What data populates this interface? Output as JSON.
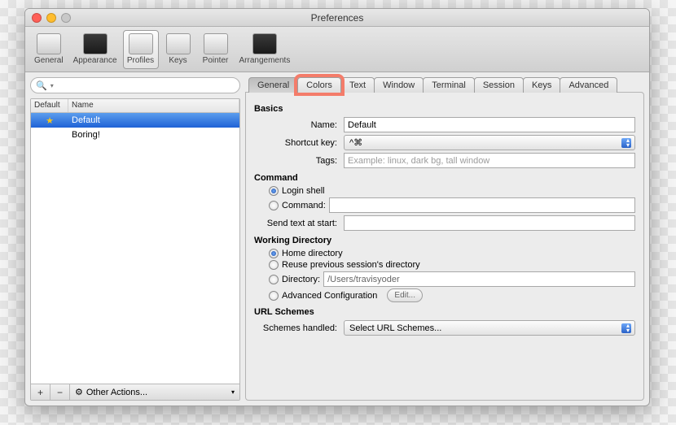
{
  "window": {
    "title": "Preferences"
  },
  "toolbar": {
    "items": [
      {
        "label": "General",
        "icon": "slider-icon"
      },
      {
        "label": "Appearance",
        "icon": "screen-icon"
      },
      {
        "label": "Profiles",
        "icon": "person-icon",
        "selected": true
      },
      {
        "label": "Keys",
        "icon": "key-icon"
      },
      {
        "label": "Pointer",
        "icon": "mouse-icon"
      },
      {
        "label": "Arrangements",
        "icon": "windows-icon"
      }
    ]
  },
  "profiles": {
    "columns": {
      "default": "Default",
      "name": "Name"
    },
    "rows": [
      {
        "default": true,
        "name": "Default",
        "selected": true
      },
      {
        "default": false,
        "name": "Boring!",
        "selected": false
      }
    ],
    "footer": {
      "add": "+",
      "remove": "−",
      "other_actions": "Other Actions..."
    }
  },
  "search": {
    "placeholder": ""
  },
  "tabs": [
    "General",
    "Colors",
    "Text",
    "Window",
    "Terminal",
    "Session",
    "Keys",
    "Advanced"
  ],
  "active_tab": "General",
  "highlighted_tab": "Colors",
  "form": {
    "basics": {
      "title": "Basics",
      "name_label": "Name:",
      "name_value": "Default",
      "shortcut_label": "Shortcut key:",
      "shortcut_value": "^⌘",
      "tags_label": "Tags:",
      "tags_placeholder": "Example: linux, dark bg, tall window"
    },
    "command": {
      "title": "Command",
      "login_shell": "Login shell",
      "command": "Command:",
      "send_text_label": "Send text at start:"
    },
    "working_dir": {
      "title": "Working Directory",
      "home": "Home directory",
      "reuse": "Reuse previous session's directory",
      "directory_label": "Directory:",
      "directory_value": "/Users/travisyoder",
      "advanced": "Advanced Configuration",
      "edit_btn": "Edit..."
    },
    "url_schemes": {
      "title": "URL Schemes",
      "label": "Schemes handled:",
      "value": "Select URL Schemes..."
    }
  }
}
